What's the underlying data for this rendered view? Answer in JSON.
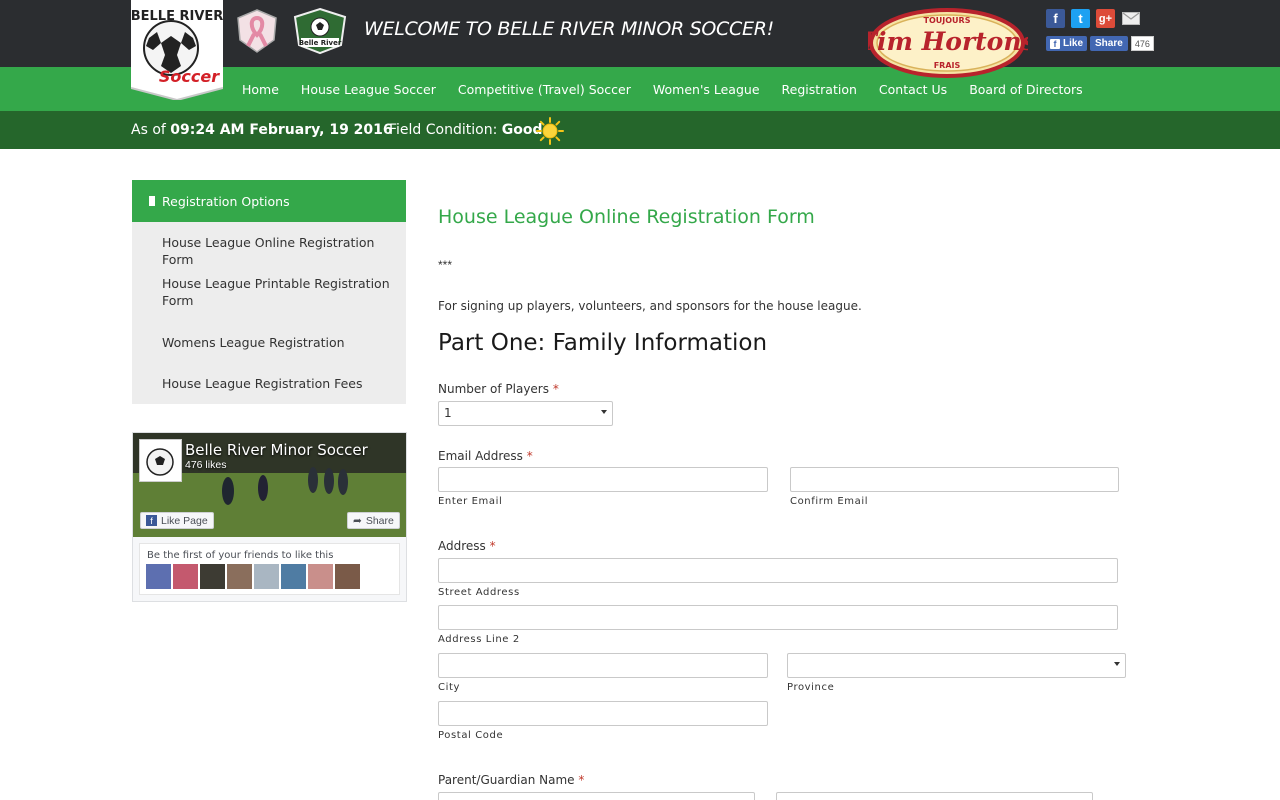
{
  "header": {
    "logo_text_top": "BELLE RIVER",
    "logo_text_bottom": "Soccer",
    "club_logo_text": "Belle River",
    "welcome": "WELCOME TO BELLE RIVER MINOR SOCCER!",
    "sponsor": {
      "name": "Tim Hortons",
      "top_text": "TOUJOURS",
      "bottom_text": "FRAIS"
    },
    "social": {
      "facebook_icon": "facebook-icon",
      "twitter_icon": "twitter-icon",
      "google_icon": "google-plus-icon",
      "email_icon": "email-icon",
      "like_label": "Like",
      "share_label": "Share",
      "count": "476"
    }
  },
  "nav": {
    "items": [
      "Home",
      "House League Soccer",
      "Competitive (Travel) Soccer",
      "Women's League",
      "Registration",
      "Contact Us",
      "Board of Directors"
    ]
  },
  "status": {
    "asof_label": "As of",
    "asof_value": "09:24 AM February, 19 2016",
    "field_label": "Field Condition:",
    "field_value": "Good"
  },
  "sidebar": {
    "header": "Registration Options",
    "items": [
      "House League Online Registration Form",
      "House League Printable Registration Form",
      "Womens League Registration",
      "House League Registration Fees"
    ]
  },
  "fb_widget": {
    "page_name": "Belle River Minor Soccer",
    "likes": "476 likes",
    "like_page": "Like Page",
    "share": "Share",
    "friends_text": "Be the first of your friends to like this"
  },
  "main": {
    "title": "House League Online Registration Form",
    "stars": "***",
    "intro": "For signing up players, volunteers, and sponsors for the house league.",
    "part_title": "Part One: Family Information",
    "fields": {
      "players_label": "Number of Players",
      "players_value": "1",
      "email_label": "Email Address",
      "enter_email": "Enter Email",
      "confirm_email": "Confirm Email",
      "address_label": "Address",
      "street": "Street Address",
      "line2": "Address Line 2",
      "city": "City",
      "province": "Province",
      "postal": "Postal Code",
      "guardian_label": "Parent/Guardian Name",
      "required_mark": "*"
    }
  },
  "colors": {
    "nav_green": "#34a84a",
    "status_green": "#25662b",
    "topbar": "#2b2d30",
    "title_green": "#34a84a",
    "required_red": "#c0392b"
  }
}
